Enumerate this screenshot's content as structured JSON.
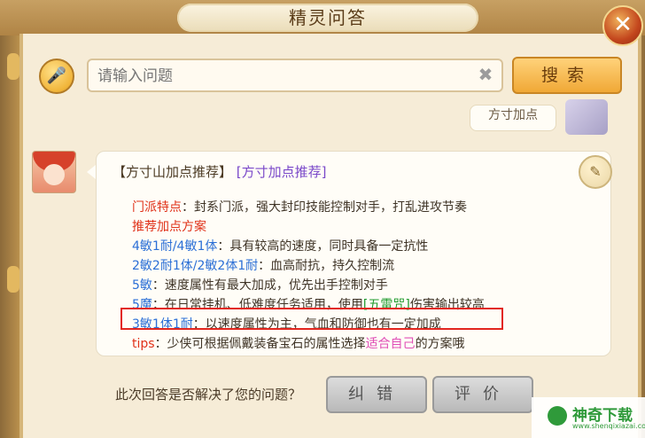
{
  "window": {
    "title": "精灵问答",
    "close_label": "✕"
  },
  "search": {
    "mic_icon": "microphone-icon",
    "placeholder": "请输入问题",
    "clear_label": "✖",
    "button_label": "搜索"
  },
  "history": {
    "user_question": "方寸加点"
  },
  "answer": {
    "header_title": "【方寸山加点推荐】",
    "header_link": "[方寸加点推荐]",
    "lines": [
      {
        "prefix": "门派特点",
        "text": "：封系门派，强大封印技能控制对手，打乱进攻节奏"
      },
      {
        "prefix": "推荐加点方案",
        "text": ""
      },
      {
        "prefix": "4敏1耐/4敏1体",
        "text": "：具有较高的速度，同时具备一定抗性"
      },
      {
        "prefix": "2敏2耐1体/2敏2体1耐",
        "text": "：血高耐抗，持久控制流"
      },
      {
        "prefix": "5敏",
        "text": "：速度属性有最大加成，优先出手控制对手"
      },
      {
        "prefix": "5魔",
        "text": "：在日常挂机、低难度任务适用，使用",
        "tag": "[五雷咒]",
        "tail": "伤害输出较高"
      },
      {
        "prefix": "3敏1体1耐",
        "text": "：以速度属性为主，气血和防御也有一定加成"
      },
      {
        "prefix": "tips",
        "text": "：少侠可根据佩戴装备宝石的属性选择",
        "tag": "适合自己",
        "tail": "的方案哦"
      }
    ]
  },
  "footer": {
    "question": "此次回答是否解决了您的问题？",
    "correct_label": "纠错",
    "rate_label": "评价"
  },
  "watermark": {
    "brand": "神奇下载",
    "url": "www.shenqixiazai.com"
  }
}
